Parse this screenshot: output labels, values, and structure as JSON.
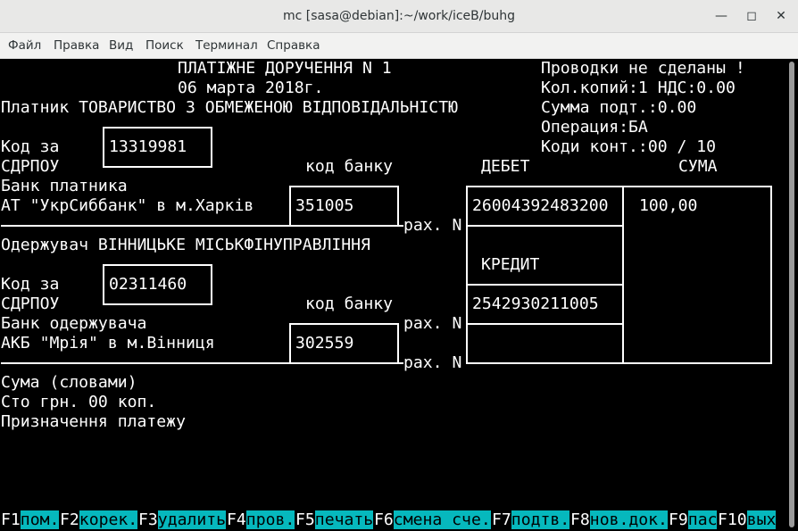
{
  "window": {
    "title": "mc [sasa@debian]:~/work/iceB/buhg"
  },
  "menu": [
    "Файл",
    "Правка",
    "Вид",
    "Поиск",
    "Терминал",
    "Справка"
  ],
  "doc": {
    "heading": "ПЛАТІЖНЕ ДОРУЧЕННЯ N 1",
    "date": "06 марта 2018г.",
    "payer_line": "Платник ТОВАРИСТВО З ОБМЕЖЕНОЮ ВІДПОВІДАЛЬНІСТЮ",
    "status": "Проводки не сделаны !",
    "copies": "Кол.копий:1 НДС:0.00",
    "sum_sub": "Сумма подт.:0.00",
    "operation": "Операция:БА",
    "codes": "Коди конт.:00 / 10",
    "kod_za": "Код за",
    "edrpou": "СДРПОУ",
    "payer_code": "13319981",
    "kod_banku": "код банку",
    "debit": "ДЕБЕТ",
    "suma": "СУМА",
    "payer_bank_label": "Банк платника",
    "payer_bank": "АТ \"УкрСиббанк\" в м.Харків",
    "payer_mfo": "351005",
    "payer_account": "26004392483200",
    "amount": "100,00",
    "rah": "рах. N",
    "recipient_line": "Одержувач ВІННИЦЬКЕ МІСЬКФІНУПРАВЛІННЯ",
    "credit": "КРЕДИТ",
    "recipient_code": "02311460",
    "recipient_account": "2542930211005",
    "recipient_bank_label": "Банк одержувача",
    "recipient_bank": "АКБ \"Мрія\" в м.Вінниця",
    "recipient_mfo": "302559",
    "sum_words_label": "Сума (словами)",
    "sum_words": "Сто грн. 00 коп.",
    "purpose": "Призначення платежу"
  },
  "fkeys": [
    {
      "key": "F1",
      "label": "пом."
    },
    {
      "key": "F2",
      "label": "корек."
    },
    {
      "key": "F3",
      "label": "удалить"
    },
    {
      "key": "F4",
      "label": "пров."
    },
    {
      "key": "F5",
      "label": "печать"
    },
    {
      "key": "F6",
      "label": "смена сче."
    },
    {
      "key": "F7",
      "label": "подтв."
    },
    {
      "key": "F8",
      "label": "нов.док."
    },
    {
      "key": "F9",
      "label": "пас"
    },
    {
      "key": "F10",
      "label": "вых"
    }
  ]
}
